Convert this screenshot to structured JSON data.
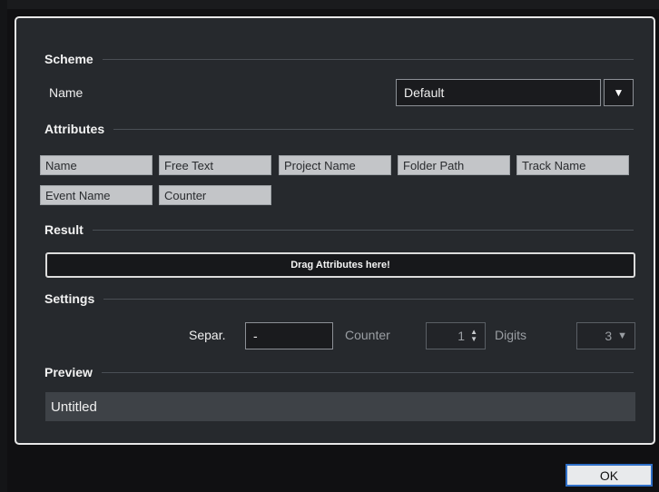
{
  "sections": {
    "scheme": "Scheme",
    "attributes": "Attributes",
    "result": "Result",
    "settings": "Settings",
    "preview": "Preview"
  },
  "scheme": {
    "name_label": "Name",
    "selected": "Default",
    "dropdown_icon": "triangle-down"
  },
  "attributes": {
    "chips": [
      "Name",
      "Free Text",
      "Project Name",
      "Folder Path",
      "Track Name",
      "Event Name",
      "Counter"
    ]
  },
  "result": {
    "dropzone_text": "Drag Attributes here!"
  },
  "settings": {
    "separator_label": "Separ.",
    "separator_value": "-",
    "counter_label": "Counter",
    "counter_value": "1",
    "digits_label": "Digits",
    "digits_value": "3"
  },
  "preview": {
    "value": "Untitled"
  },
  "footer": {
    "ok_label": "OK"
  },
  "colors": {
    "panel_bg": "#26292d",
    "accent_focus": "#2f6fc7",
    "chip_light": "#c3c5c8",
    "chip_dark": "#3d4146"
  }
}
